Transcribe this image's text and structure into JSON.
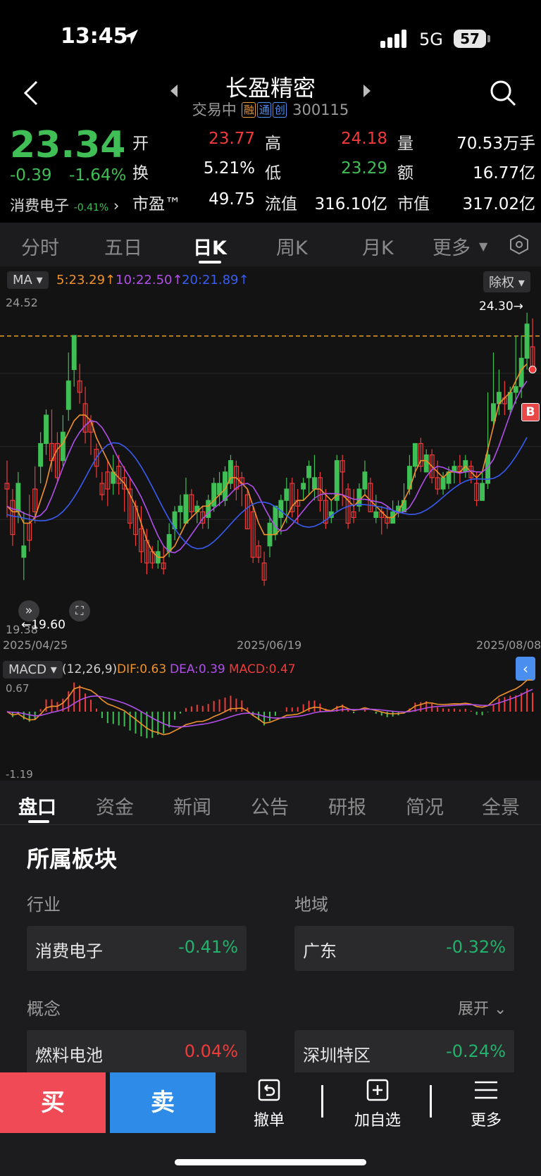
{
  "status_bar": {
    "time": "13:45",
    "network": "5G",
    "battery": "57"
  },
  "header": {
    "title": "长盈精密",
    "status": "交易中",
    "tags": [
      "融",
      "通",
      "创"
    ],
    "code": "300115"
  },
  "quote": {
    "price": "23.34",
    "change": "-0.39",
    "change_pct": "-1.64%",
    "sector_name": "消费电子",
    "sector_pct": "-0.41%",
    "rows": [
      [
        {
          "label": "开",
          "value": "23.77",
          "color": "#f23a3a"
        },
        {
          "label": "高",
          "value": "24.18",
          "color": "#f23a3a"
        },
        {
          "label": "量",
          "value": "70.53万手",
          "color": "#ffffff"
        }
      ],
      [
        {
          "label": "换",
          "value": "5.21%",
          "color": "#ffffff"
        },
        {
          "label": "低",
          "value": "23.29",
          "color": "#3fbf55"
        },
        {
          "label": "额",
          "value": "16.77亿",
          "color": "#ffffff"
        }
      ],
      [
        {
          "label": "市盈™",
          "value": "49.75",
          "color": "#ffffff"
        },
        {
          "label": "流值",
          "value": "316.10亿",
          "color": "#ffffff"
        },
        {
          "label": "市值",
          "value": "317.02亿",
          "color": "#ffffff"
        }
      ]
    ]
  },
  "chart_tabs": [
    "分时",
    "五日",
    "日K",
    "周K",
    "月K",
    "更多"
  ],
  "active_chart_tab": "日K",
  "ma_bar": {
    "label": "MA",
    "ma5": "5:23.29↑",
    "ma10": "10:22.50↑",
    "ma20": "20:21.89↑",
    "adjust": "除权"
  },
  "kline": {
    "y_high_label": "24.52",
    "y_low_label": "19.38",
    "max_marker": "24.30→",
    "min_marker": "←19.60",
    "dates": [
      "2025/04/25",
      "2025/06/19",
      "2025/08/08"
    ],
    "reference_price": 23.34,
    "buy_marker": "B"
  },
  "macd_bar": {
    "label": "MACD",
    "params": "(12,26,9)",
    "dif": "DIF:0.63",
    "dea": "DEA:0.39",
    "macd": "MACD:0.47",
    "y_top": "0.67",
    "y_bottom": "-1.19"
  },
  "bottom_tabs": [
    "盘口",
    "资金",
    "新闻",
    "公告",
    "研报",
    "简况",
    "全景"
  ],
  "sector_section": {
    "title": "所属板块",
    "industry_label": "行业",
    "region_label": "地域",
    "concept_label": "概念",
    "expand_label": "展开",
    "cards": [
      {
        "name": "消费电子",
        "pct": "-0.41%",
        "color": "#21b36b"
      },
      {
        "name": "广东",
        "pct": "-0.32%",
        "color": "#21b36b"
      },
      {
        "name": "燃料电池",
        "pct": "0.04%",
        "color": "#f23a3a"
      },
      {
        "name": "深圳特区",
        "pct": "-0.24%",
        "color": "#21b36b"
      }
    ]
  },
  "toolbar": {
    "buy": "买",
    "sell": "卖",
    "cancel": "撤单",
    "add_watch": "加自选",
    "more": "更多"
  },
  "chart_data": {
    "type": "candlestick",
    "ylim": [
      19.38,
      24.52
    ],
    "candles": [
      [
        21.3,
        21.2,
        21.7,
        20.7
      ],
      [
        21.0,
        20.4,
        21.2,
        20.2
      ],
      [
        20.8,
        21.3,
        21.5,
        20.6
      ],
      [
        20.0,
        20.2,
        20.8,
        19.6
      ],
      [
        20.6,
        20.3,
        21.1,
        20.1
      ],
      [
        21.2,
        20.8,
        21.6,
        20.6
      ],
      [
        21.6,
        22.0,
        22.2,
        21.3
      ],
      [
        22.0,
        22.5,
        22.6,
        21.8
      ],
      [
        22.0,
        21.7,
        22.6,
        21.5
      ],
      [
        22.0,
        21.4,
        22.2,
        21.3
      ],
      [
        21.7,
        22.2,
        22.5,
        21.6
      ],
      [
        22.6,
        23.1,
        23.6,
        22.4
      ],
      [
        23.3,
        23.9,
        23.9,
        23.0
      ],
      [
        23.1,
        22.9,
        23.4,
        22.7
      ],
      [
        22.7,
        22.2,
        23.0,
        22.0
      ],
      [
        22.4,
        22.2,
        22.5,
        21.8
      ],
      [
        21.9,
        21.6,
        22.0,
        21.4
      ],
      [
        21.3,
        21.1,
        21.5,
        21.0
      ],
      [
        21.5,
        21.2,
        21.7,
        20.9
      ],
      [
        21.3,
        21.5,
        21.8,
        21.1
      ],
      [
        21.6,
        21.3,
        21.8,
        21.1
      ],
      [
        21.4,
        21.2,
        21.6,
        20.8
      ],
      [
        21.2,
        20.6,
        21.4,
        20.5
      ],
      [
        20.9,
        20.4,
        21.0,
        20.2
      ],
      [
        20.5,
        20.1,
        20.9,
        19.9
      ],
      [
        20.3,
        19.9,
        20.5,
        19.7
      ],
      [
        20.1,
        19.9,
        20.2,
        19.8
      ],
      [
        19.9,
        20.1,
        20.3,
        19.8
      ],
      [
        19.9,
        19.8,
        20.2,
        19.7
      ],
      [
        20.1,
        20.4,
        20.6,
        20.0
      ],
      [
        20.5,
        20.8,
        20.9,
        20.3
      ],
      [
        20.8,
        20.9,
        21.1,
        20.5
      ],
      [
        20.6,
        21.1,
        21.4,
        20.6
      ],
      [
        21.1,
        20.8,
        21.2,
        20.7
      ],
      [
        20.8,
        20.9,
        21.0,
        20.6
      ],
      [
        20.8,
        20.6,
        20.9,
        20.5
      ],
      [
        20.7,
        21.0,
        21.1,
        20.5
      ],
      [
        20.9,
        21.3,
        21.4,
        20.8
      ],
      [
        21.1,
        21.3,
        21.5,
        20.9
      ],
      [
        21.0,
        21.5,
        21.6,
        20.9
      ],
      [
        21.3,
        21.7,
        21.8,
        21.2
      ],
      [
        21.6,
        21.2,
        21.7,
        21.0
      ],
      [
        21.4,
        21.3,
        21.5,
        20.9
      ],
      [
        21.1,
        20.5,
        21.2,
        20.5
      ],
      [
        20.8,
        20.0,
        20.9,
        19.9
      ],
      [
        20.2,
        20.0,
        20.3,
        19.9
      ],
      [
        19.9,
        19.6,
        20.1,
        19.5
      ],
      [
        20.2,
        20.6,
        20.7,
        20.0
      ],
      [
        20.4,
        20.9,
        20.9,
        20.3
      ],
      [
        20.7,
        21.0,
        21.1,
        20.4
      ],
      [
        21.0,
        21.2,
        21.4,
        20.6
      ],
      [
        21.3,
        20.8,
        21.4,
        20.7
      ],
      [
        21.0,
        20.9,
        21.2,
        20.6
      ],
      [
        21.2,
        21.3,
        21.4,
        21.0
      ],
      [
        21.4,
        21.6,
        21.7,
        21.1
      ],
      [
        21.2,
        21.4,
        21.8,
        21.0
      ],
      [
        21.4,
        21.0,
        21.5,
        20.8
      ],
      [
        21.0,
        20.6,
        21.2,
        20.5
      ],
      [
        20.7,
        20.8,
        21.0,
        20.6
      ],
      [
        21.0,
        21.7,
        21.8,
        20.8
      ],
      [
        21.7,
        21.5,
        21.8,
        20.9
      ],
      [
        21.2,
        20.6,
        21.3,
        20.5
      ],
      [
        20.8,
        20.7,
        21.2,
        20.6
      ],
      [
        20.9,
        21.2,
        21.3,
        20.8
      ],
      [
        21.2,
        21.5,
        21.7,
        21.1
      ],
      [
        21.3,
        20.8,
        21.4,
        20.8
      ],
      [
        20.7,
        20.8,
        21.1,
        20.6
      ],
      [
        20.8,
        20.7,
        20.9,
        20.4
      ],
      [
        20.7,
        20.6,
        20.9,
        20.5
      ],
      [
        20.6,
        20.8,
        21.0,
        20.6
      ],
      [
        20.8,
        20.9,
        21.0,
        20.7
      ],
      [
        20.8,
        21.0,
        21.3,
        20.8
      ],
      [
        21.2,
        21.6,
        21.8,
        21.1
      ],
      [
        21.6,
        22.0,
        22.0,
        21.4
      ],
      [
        22.0,
        21.6,
        22.1,
        21.5
      ],
      [
        21.5,
        21.8,
        21.9,
        21.5
      ],
      [
        21.8,
        21.4,
        21.9,
        21.3
      ],
      [
        21.4,
        21.2,
        21.7,
        21.1
      ],
      [
        21.2,
        21.4,
        21.5,
        21.1
      ],
      [
        21.3,
        21.5,
        21.6,
        21.2
      ],
      [
        21.5,
        21.6,
        21.7,
        21.3
      ],
      [
        21.6,
        21.5,
        21.8,
        21.3
      ],
      [
        21.5,
        21.7,
        21.8,
        21.4
      ],
      [
        21.6,
        21.4,
        21.7,
        21.3
      ],
      [
        21.3,
        21.0,
        21.5,
        20.9
      ],
      [
        21.0,
        21.3,
        21.5,
        21.0
      ],
      [
        21.3,
        21.8,
        22.9,
        21.2
      ],
      [
        22.4,
        22.7,
        23.6,
        22.3
      ],
      [
        22.7,
        22.9,
        23.3,
        22.5
      ],
      [
        22.8,
        22.7,
        23.1,
        22.5
      ],
      [
        22.6,
        22.9,
        23.0,
        22.5
      ],
      [
        22.9,
        23.0,
        23.9,
        22.7
      ],
      [
        23.0,
        23.5,
        23.9,
        22.8
      ],
      [
        23.5,
        24.1,
        24.3,
        23.3
      ],
      [
        23.7,
        23.3,
        24.2,
        23.3
      ]
    ],
    "ma5": [
      20.9,
      20.8,
      20.8,
      20.6,
      20.6,
      20.7,
      21.0,
      21.3,
      21.7,
      21.9,
      22.0,
      22.2,
      22.4,
      22.5,
      22.5,
      22.4,
      22.1,
      21.9,
      21.7,
      21.5,
      21.4,
      21.3,
      21.1,
      20.9,
      20.6,
      20.3,
      20.1,
      20.0,
      20.0,
      20.1,
      20.2,
      20.4,
      20.6,
      20.7,
      20.8,
      20.9,
      20.9,
      21.0,
      21.1,
      21.2,
      21.4,
      21.4,
      21.3,
      21.2,
      20.9,
      20.6,
      20.4,
      20.4,
      20.4,
      20.5,
      20.7,
      20.9,
      21.0,
      21.0,
      21.1,
      21.2,
      21.2,
      21.1,
      21.0,
      21.1,
      21.1,
      21.0,
      20.9,
      21.0,
      21.1,
      21.0,
      20.9,
      20.8,
      20.7,
      20.7,
      20.8,
      21.0,
      21.2,
      21.5,
      21.7,
      21.7,
      21.6,
      21.5,
      21.4,
      21.5,
      21.5,
      21.5,
      21.6,
      21.5,
      21.4,
      21.5,
      21.9,
      22.3,
      22.7,
      22.8,
      22.9,
      23.1,
      23.3,
      23.4
    ]
  }
}
